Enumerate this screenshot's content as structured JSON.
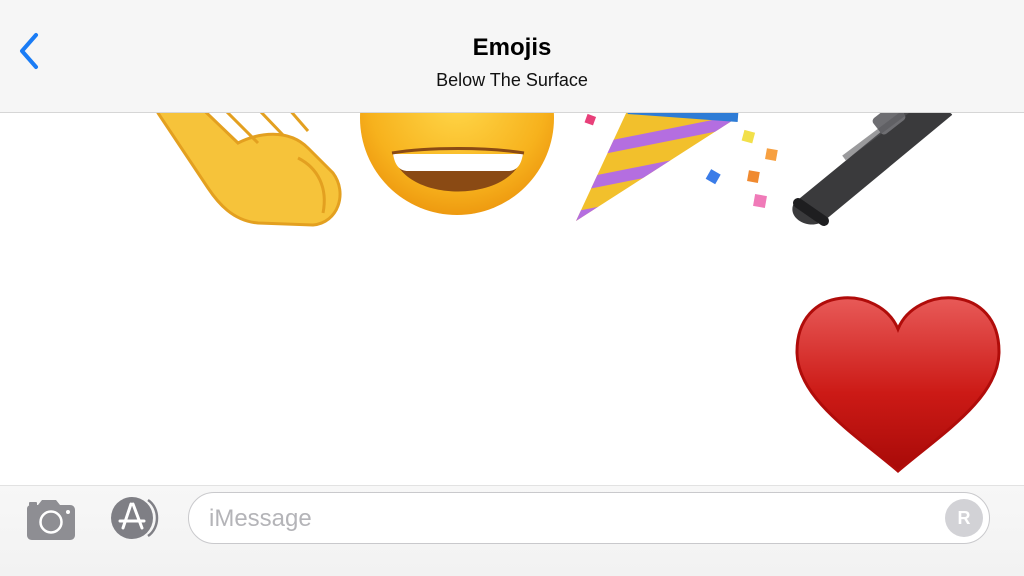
{
  "header": {
    "title": "Emojis",
    "subtitle": "Below The Surface",
    "back_icon": "chevron-left-icon",
    "accent_color": "#1a7cf5"
  },
  "messages": {
    "top_row": [
      "raised-back-of-hand-emoji",
      "grinning-face-emoji",
      "party-popper-emoji",
      "microphone-emoji"
    ],
    "sent": "heart-emoji"
  },
  "composer": {
    "camera_icon": "camera-icon",
    "apps_icon": "app-store-icon",
    "placeholder": "iMessage",
    "avatar_initial": "R"
  }
}
